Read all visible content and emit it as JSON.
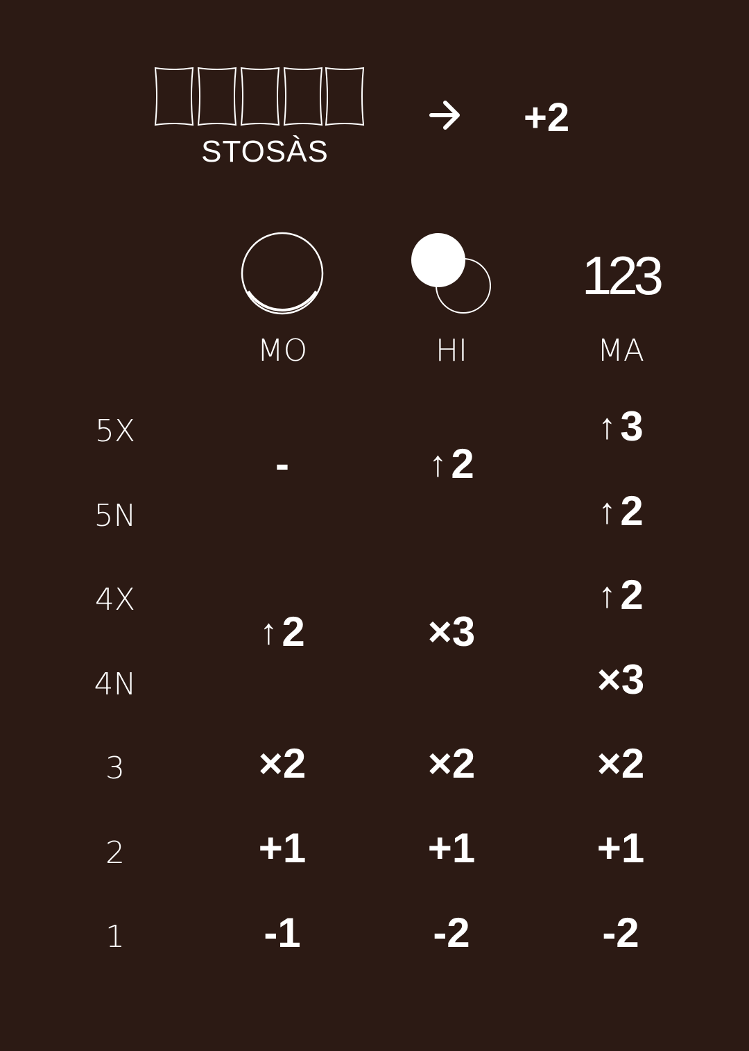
{
  "header": {
    "cards_label": "STOSÀS",
    "arrow_icon": "arrow-right-icon",
    "bonus": "+2"
  },
  "columns": [
    {
      "label": "MO",
      "icon": "open-circle-icon"
    },
    {
      "label": "HI",
      "icon": "overlapping-circles-icon"
    },
    {
      "label": "MA",
      "icon_text": "123"
    }
  ],
  "rows": [
    {
      "label": "5X"
    },
    {
      "label": "5N"
    },
    {
      "label": "4X"
    },
    {
      "label": "4N"
    },
    {
      "label": "3"
    },
    {
      "label": "2"
    },
    {
      "label": "1"
    }
  ],
  "cells": {
    "mo_5": "-",
    "hi_5": "2",
    "ma_5x": "3",
    "ma_5n": "2",
    "mo_4": "2",
    "hi_4": "×3",
    "ma_4x": "2",
    "ma_4n": "×3",
    "mo_3": "×2",
    "hi_3": "×2",
    "ma_3": "×2",
    "mo_2": "+1",
    "hi_2": "+1",
    "ma_2": "+1",
    "mo_1": "-1",
    "hi_1": "-2",
    "ma_1": "-2"
  },
  "icons": {
    "up": "↑",
    "up_icon_name": "up-arrow-icon"
  },
  "colors": {
    "background": "#2c1a14",
    "foreground": "#ffffff"
  }
}
